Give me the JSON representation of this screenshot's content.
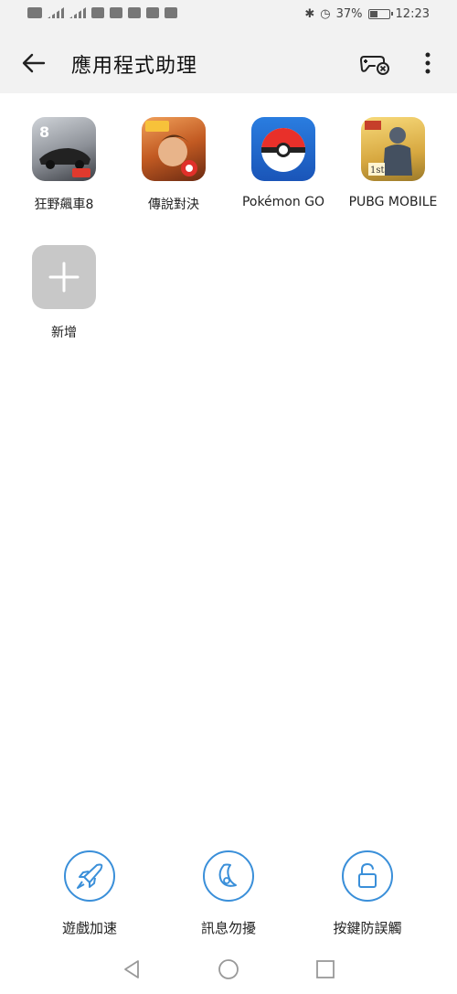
{
  "status_bar": {
    "battery": "37%",
    "battery_level": 0.37,
    "time": "12:23"
  },
  "header": {
    "title": "應用程式助理",
    "icons": [
      "back-arrow-icon",
      "gamepad-icon",
      "more-vert-icon"
    ]
  },
  "apps": [
    {
      "label": "狂野飆車8",
      "icon": "asphalt8-icon"
    },
    {
      "label": "傳說對決",
      "icon": "arena-of-valor-icon"
    },
    {
      "label": "Pokémon GO",
      "icon": "pokeball-icon"
    },
    {
      "label": "PUBG MOBILE",
      "icon": "pubg-icon"
    }
  ],
  "add_tile": {
    "label": "新增",
    "icon": "plus-icon"
  },
  "actions": [
    {
      "label": "遊戲加速",
      "icon": "rocket-icon"
    },
    {
      "label": "訊息勿擾",
      "icon": "moon-icon"
    },
    {
      "label": "按鍵防誤觸",
      "icon": "unlock-icon"
    }
  ],
  "navbar": {
    "icons": [
      "back-triangle-icon",
      "home-circle-icon",
      "recents-square-icon"
    ]
  },
  "colors": {
    "accent": "#3a8fd9",
    "header_bg": "#f2f2f2"
  }
}
